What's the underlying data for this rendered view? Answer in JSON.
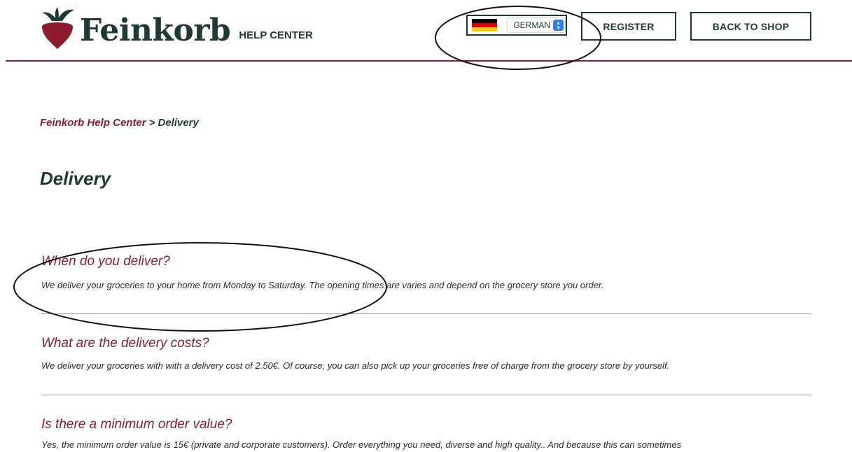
{
  "header": {
    "brand": "Feinkorb",
    "brand_sub": "HELP CENTER",
    "language": {
      "selected": "GERMAN"
    },
    "register_label": "REGISTER",
    "back_label": "BACK TO SHOP"
  },
  "breadcrumb": {
    "root": "Feinkorb Help Center",
    "separator": ">",
    "current": "Delivery"
  },
  "page_title": "Delivery",
  "faq": [
    {
      "question": "When do you deliver?",
      "answer": "We deliver your groceries to your home from Monday to Saturday. The opening times are varies and depend on the grocery store you order."
    },
    {
      "question": "What are the delivery costs?",
      "answer": "We deliver your groceries with with a delivery cost of 2.50€. Of course, you can also pick up your groceries free of charge from the grocery store by yourself."
    },
    {
      "question": "Is there a minimum order value?",
      "answer": "Yes, the minimum order value is 15€ (private and corporate customers). Order everything you need, diverse and high quality.. And because this can sometimes"
    }
  ],
  "colors": {
    "brand_red": "#8c1d2e",
    "brand_green": "#1f3a36",
    "select_accent": "#2f7ff0"
  },
  "icons": {
    "logo": "beet-logo-icon",
    "flag": "german-flag-icon",
    "select_arrows": "chevron-updown-icon"
  }
}
